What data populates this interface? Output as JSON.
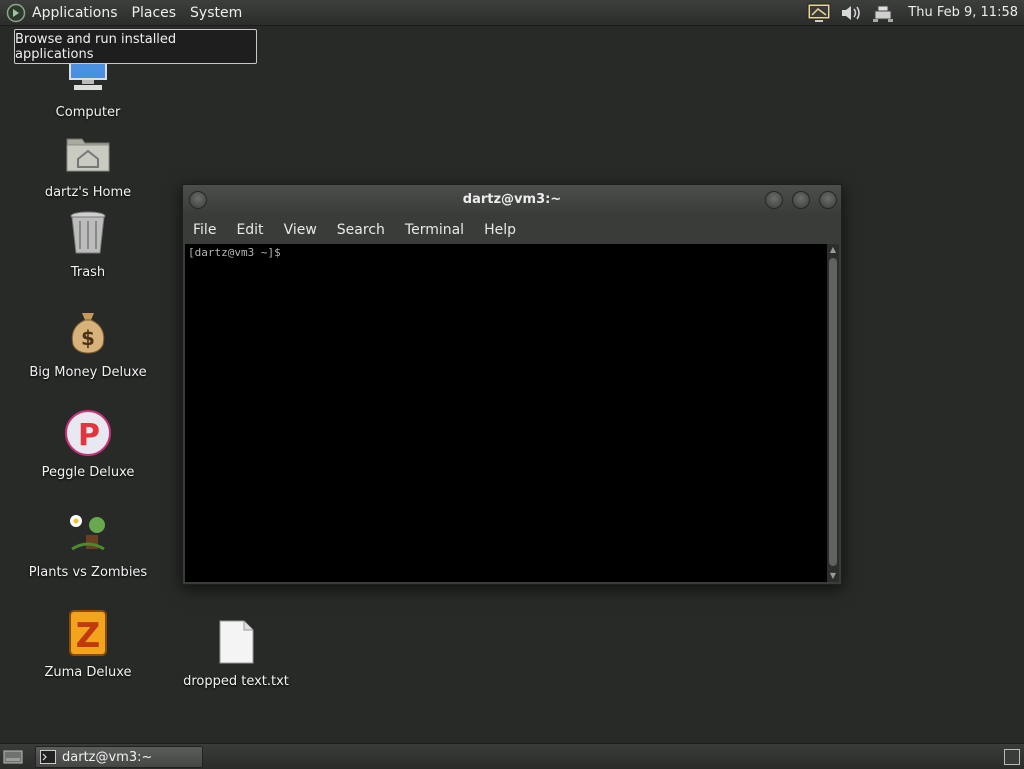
{
  "top_panel": {
    "menus": [
      "Applications",
      "Places",
      "System"
    ],
    "tray_icons": [
      "display-icon",
      "volume-icon",
      "network-icon"
    ],
    "clock": "Thu Feb  9, 11:58"
  },
  "tooltip": {
    "text": "Browse and run installed applications"
  },
  "desktop_icons": [
    {
      "label": "Computer",
      "icon": "computer-icon"
    },
    {
      "label": "dartz's Home",
      "icon": "home-folder-icon"
    },
    {
      "label": "Trash",
      "icon": "trash-icon"
    },
    {
      "label": "Big Money Deluxe",
      "icon": "money-bag-icon"
    },
    {
      "label": "Peggle Deluxe",
      "icon": "peggle-icon"
    },
    {
      "label": "Plants vs Zombies",
      "icon": "plants-icon"
    },
    {
      "label": "Zuma Deluxe",
      "icon": "zuma-icon"
    },
    {
      "label": "dropped text.txt",
      "icon": "text-file-icon"
    }
  ],
  "terminal": {
    "title": "dartz@vm3:~",
    "menu": [
      "File",
      "Edit",
      "View",
      "Search",
      "Terminal",
      "Help"
    ],
    "prompt": "[dartz@vm3 ~]$"
  },
  "taskbar": {
    "task_label": "dartz@vm3:~"
  }
}
